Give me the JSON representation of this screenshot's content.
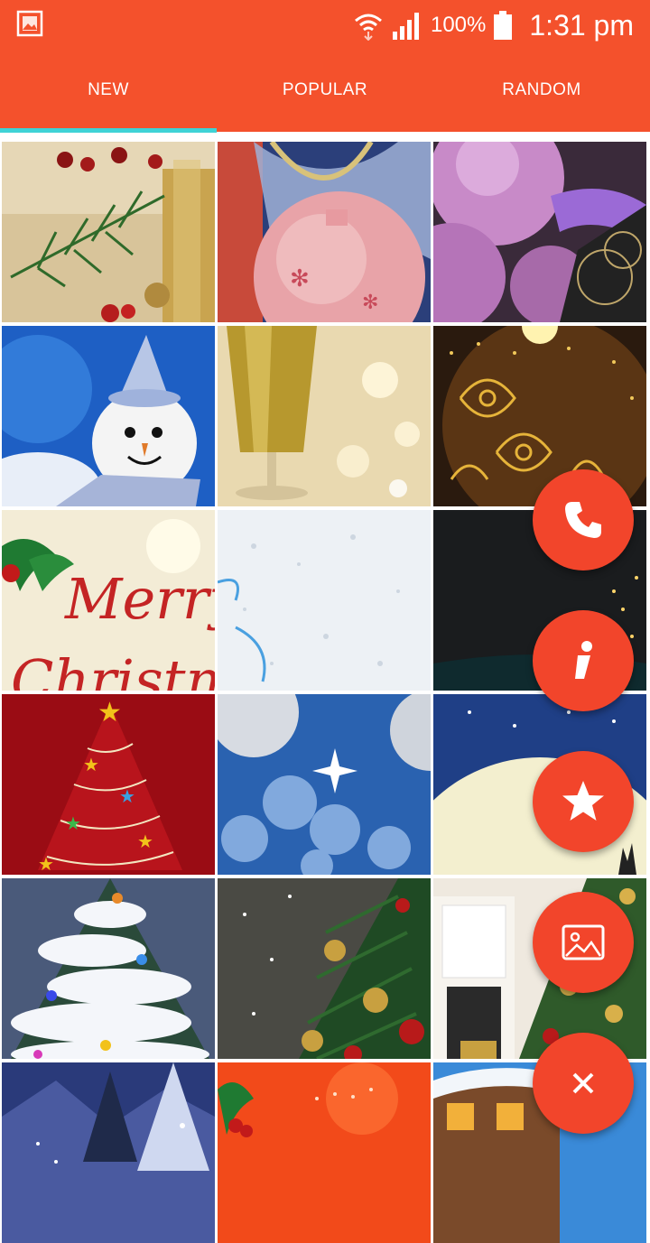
{
  "statusbar": {
    "battery": "100%",
    "time": "1:31 pm"
  },
  "tabs": [
    {
      "label": "NEW",
      "selected": true
    },
    {
      "label": "POPULAR",
      "selected": false
    },
    {
      "label": "RANDOM",
      "selected": false
    }
  ],
  "tiles": [
    {
      "subject": "pine branch with gift and berries"
    },
    {
      "subject": "pink ornament with ribbon"
    },
    {
      "subject": "purple baubles"
    },
    {
      "subject": "snowman"
    },
    {
      "subject": "champagne glass"
    },
    {
      "subject": "golden ornament pattern"
    },
    {
      "subject": "merry christmas card",
      "text_line1": "Merry",
      "text_line2": "Christmas"
    },
    {
      "subject": "snow texture"
    },
    {
      "subject": "dark with lights"
    },
    {
      "subject": "red starry tree"
    },
    {
      "subject": "blue bokeh ornaments"
    },
    {
      "subject": "moon night"
    },
    {
      "subject": "snowy tree with lights"
    },
    {
      "subject": "christmas tree with baubles"
    },
    {
      "subject": "fireplace and tree"
    },
    {
      "subject": "snowy village night"
    },
    {
      "subject": "orange with holly"
    },
    {
      "subject": "snowy house"
    }
  ],
  "fabs": [
    {
      "icon": "phone-icon"
    },
    {
      "icon": "info-icon"
    },
    {
      "icon": "star-icon"
    },
    {
      "icon": "image-icon"
    },
    {
      "icon": "close-icon"
    }
  ],
  "colors": {
    "primary": "#f4512c",
    "accent": "#3fd3d6",
    "fab": "#f2452b"
  }
}
